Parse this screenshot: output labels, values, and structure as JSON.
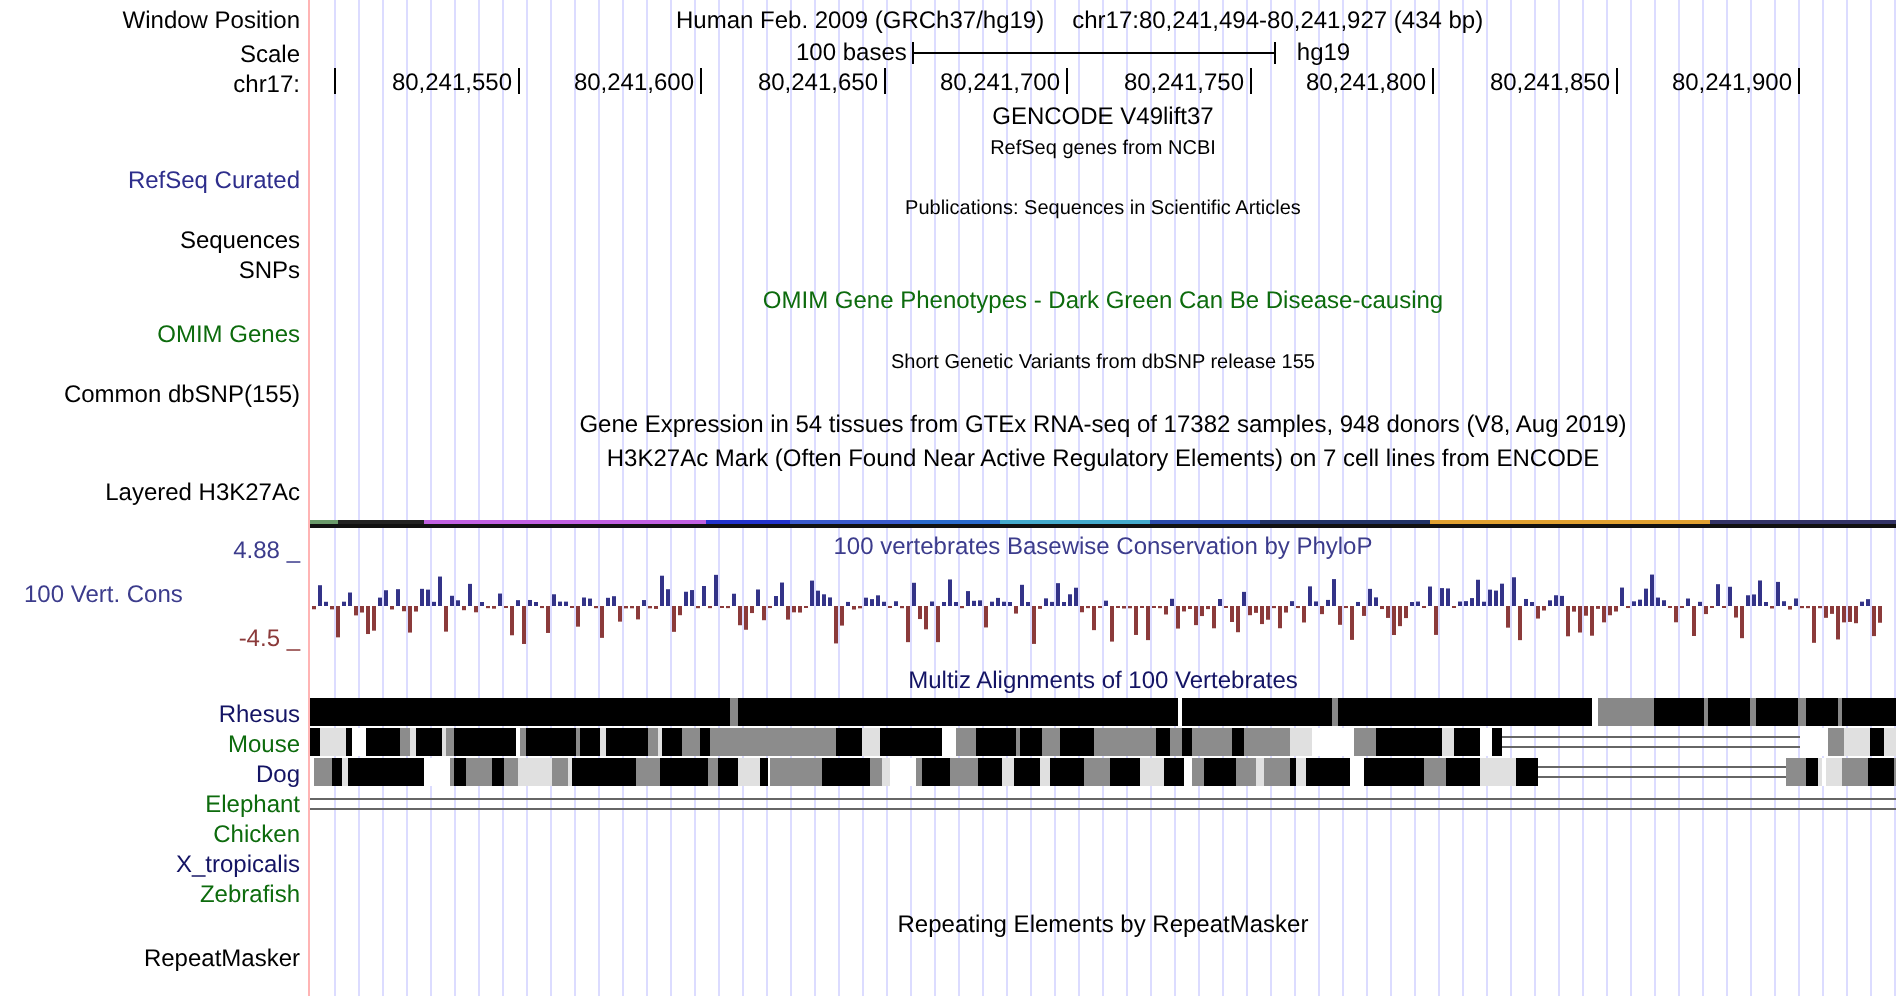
{
  "header": {
    "window_position_label": "Window Position",
    "assembly": "Human Feb. 2009 (GRCh37/hg19)",
    "position": "chr17:80,241,494-80,241,927 (434 bp)",
    "scale_label": "Scale",
    "scale_text": "100 bases",
    "scale_db": "hg19",
    "chrom_label": "chr17:",
    "ruler_labels": [
      "80,241,550",
      "80,241,600",
      "80,241,650",
      "80,241,700",
      "80,241,750",
      "80,241,800",
      "80,241,850",
      "80,241,900"
    ]
  },
  "tracks": [
    {
      "kind": "title",
      "title": "GENCODE V49lift37",
      "color": "#000000"
    },
    {
      "kind": "subtitle",
      "title": "RefSeq genes from NCBI",
      "color": "#000000"
    },
    {
      "kind": "label",
      "label": "RefSeq Curated",
      "color": "#2e2e8c"
    },
    {
      "kind": "subtitle",
      "title": "Publications: Sequences in Scientific Articles",
      "color": "#000000"
    },
    {
      "kind": "label",
      "label": "Sequences",
      "color": "#000000"
    },
    {
      "kind": "label",
      "label": "SNPs",
      "color": "#000000"
    },
    {
      "kind": "title",
      "title": "OMIM Gene Phenotypes - Dark Green Can Be Disease-causing",
      "color": "#0d6b0d"
    },
    {
      "kind": "label",
      "label": "OMIM Genes",
      "color": "#0d6b0d"
    },
    {
      "kind": "subtitle",
      "title": "Short Genetic Variants from dbSNP release 155",
      "color": "#000000"
    },
    {
      "kind": "label",
      "label": "Common dbSNP(155)",
      "color": "#000000"
    },
    {
      "kind": "title",
      "title": "Gene Expression in 54 tissues from GTEx RNA-seq of 17382 samples, 948 donors (V8, Aug 2019)",
      "color": "#000000"
    },
    {
      "kind": "title",
      "title": "H3K27Ac Mark (Often Found Near Active Regulatory Elements) on 7 cell lines from ENCODE",
      "color": "#000000"
    },
    {
      "kind": "label",
      "label": "Layered H3K27Ac",
      "color": "#000000"
    },
    {
      "kind": "signal"
    },
    {
      "kind": "conservation",
      "title": "100 vertebrates Basewise Conservation by PhyloP",
      "label": "100 Vert. Cons",
      "max": "4.88 _",
      "min": "-4.5 _",
      "color": "#3c3c8c"
    },
    {
      "kind": "title",
      "title": "Multiz Alignments of 100 Vertebrates",
      "color": "#141464"
    },
    {
      "kind": "species",
      "label": "Rhesus",
      "color": "#141464"
    },
    {
      "kind": "species",
      "label": "Mouse",
      "color": "#0d6b0d"
    },
    {
      "kind": "species",
      "label": "Dog",
      "color": "#141464"
    },
    {
      "kind": "species",
      "label": "Elephant",
      "color": "#0d6b0d"
    },
    {
      "kind": "species",
      "label": "Chicken",
      "color": "#0d6b0d"
    },
    {
      "kind": "species",
      "label": "X_tropicalis",
      "color": "#141464"
    },
    {
      "kind": "species",
      "label": "Zebrafish",
      "color": "#0d6b0d"
    },
    {
      "kind": "title",
      "title": "Repeating Elements by RepeatMasker",
      "color": "#000000"
    },
    {
      "kind": "label",
      "label": "RepeatMasker",
      "color": "#000000"
    }
  ]
}
